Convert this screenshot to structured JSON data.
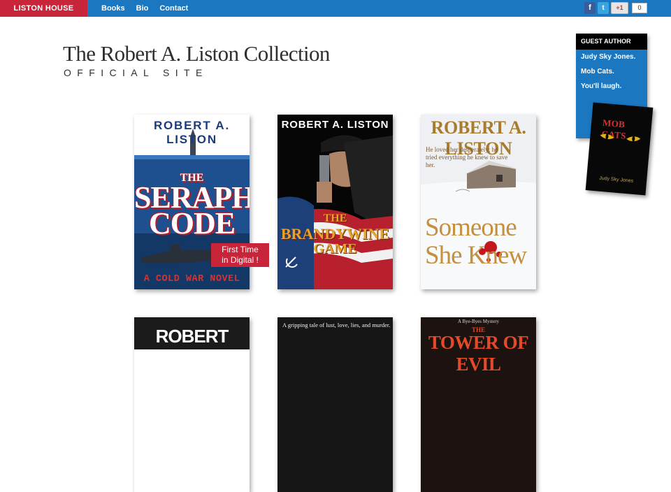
{
  "nav": {
    "brand": "LISTON HOUSE",
    "links": [
      "Books",
      "Bio",
      "Contact"
    ]
  },
  "social": {
    "facebook": "f",
    "twitter": "t",
    "gplus": "+1",
    "count": "0"
  },
  "header": {
    "title": "The Robert A. Liston Collection",
    "subtitle": "OFFICIAL SITE"
  },
  "guest_author": {
    "heading": "GUEST AUTHOR",
    "lines": [
      "Judy Sky Jones.",
      "Mob Cats.",
      "You'll laugh."
    ],
    "book_title": "MOB CATS",
    "book_author": "Judy Sky Jones"
  },
  "books": [
    {
      "author": "ROBERT A. LISTON",
      "title_top": "THE",
      "title_mid": "SERAPHIM",
      "title_bottom": "CODE",
      "tagline": "A COLD WAR NOVEL",
      "badge": [
        "First Time",
        "in Digital !"
      ]
    },
    {
      "author": "ROBERT A. LISTON",
      "title_top": "THE",
      "title_mid": "BRANDYWINE",
      "title_bottom": "GAME"
    },
    {
      "author": "ROBERT A. LISTON",
      "blurb": "He loved her desperately; he tried everything he knew to save her.",
      "title_top": "Someone",
      "title_bottom": "She Knew"
    },
    {
      "author": "ROBERT A.LISTON"
    },
    {
      "tagline": "A gripping tale of lust, love, lies, and murder."
    },
    {
      "series": "A Bye-Byes Mystery",
      "title_top": "THE",
      "title_bottom": "TOWER OF EVIL"
    }
  ],
  "colors": {
    "nav_blue": "#1a77c0",
    "brand_red": "#c8243a",
    "guest_black": "#000000"
  }
}
